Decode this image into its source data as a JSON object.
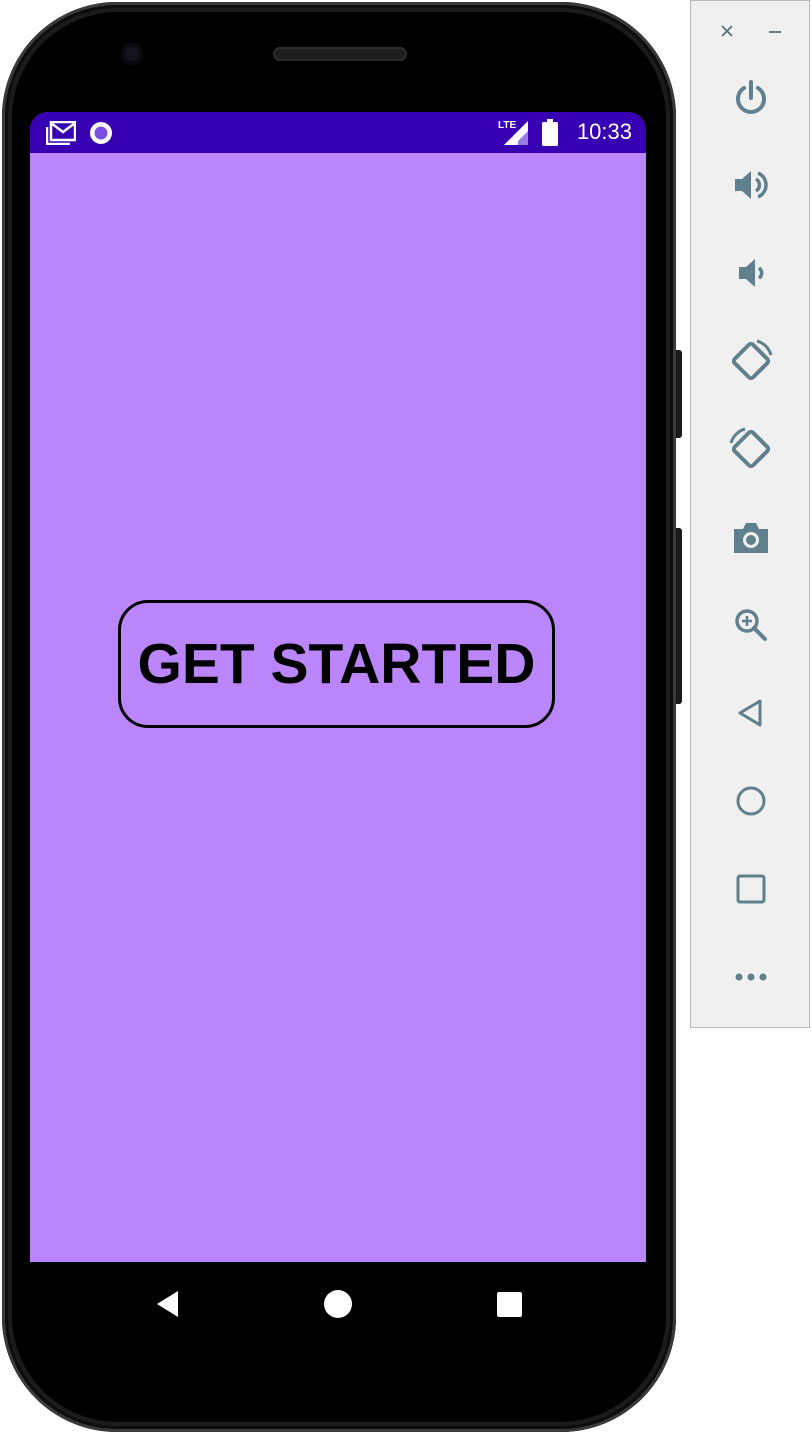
{
  "status_bar": {
    "time": "10:33",
    "network": "LTE",
    "background_color": "#3700b3",
    "icons": [
      "gmail-icon",
      "notification-circle-icon",
      "lte-signal-icon",
      "battery-icon"
    ]
  },
  "screen": {
    "background_color": "#bb86fc",
    "get_started_label": "GET STARTED"
  },
  "nav_bar": {
    "buttons": [
      "back-icon",
      "home-icon",
      "recents-icon"
    ]
  },
  "emulator_toolbar": {
    "top_controls": [
      "close-icon",
      "minimize-icon"
    ],
    "buttons": [
      "power-icon",
      "volume-up-icon",
      "volume-down-icon",
      "rotate-left-icon",
      "rotate-right-icon",
      "camera-icon",
      "zoom-icon",
      "back-icon",
      "home-icon",
      "overview-icon",
      "more-icon"
    ]
  }
}
